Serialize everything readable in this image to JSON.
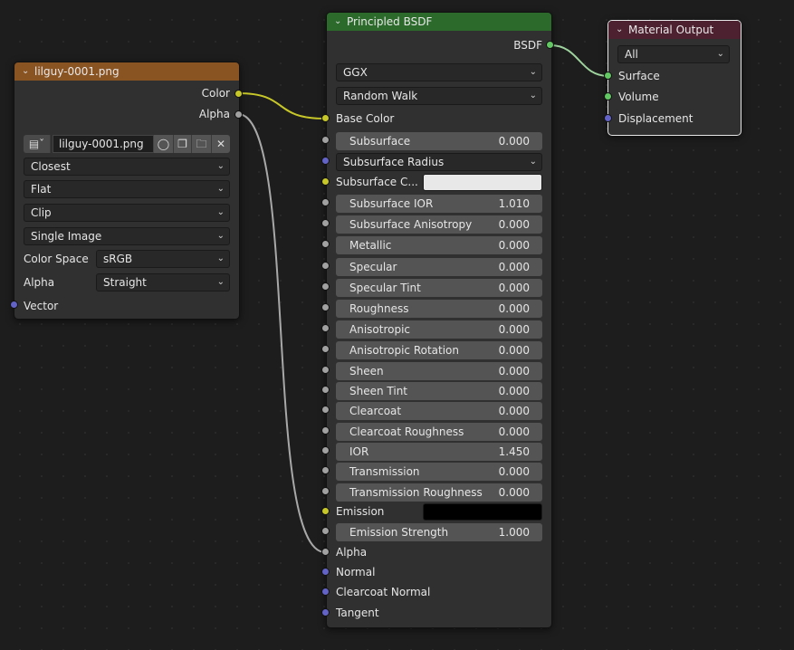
{
  "image_node": {
    "title": "lilguy-0001.png",
    "outputs": {
      "color": "Color",
      "alpha": "Alpha"
    },
    "image_name": "lilguy-0001.png",
    "interpolation": "Closest",
    "projection": "Flat",
    "extension": "Clip",
    "source": "Single Image",
    "color_space_label": "Color Space",
    "color_space": "sRGB",
    "alpha_label": "Alpha",
    "alpha_mode": "Straight",
    "input_vector": "Vector"
  },
  "bsdf_node": {
    "title": "Principled BSDF",
    "output": "BSDF",
    "distribution": "GGX",
    "subsurface_method": "Random Walk",
    "base_color": "Base Color",
    "fields": [
      {
        "label": "Subsurface",
        "value": "0.000"
      },
      {
        "label": "Subsurface Radius",
        "value": ""
      },
      {
        "label": "Subsurface C...",
        "value": ""
      },
      {
        "label": "Subsurface IOR",
        "value": "1.010"
      },
      {
        "label": "Subsurface Anisotropy",
        "value": "0.000"
      },
      {
        "label": "Metallic",
        "value": "0.000"
      },
      {
        "label": "Specular",
        "value": "0.000"
      },
      {
        "label": "Specular Tint",
        "value": "0.000"
      },
      {
        "label": "Roughness",
        "value": "0.000"
      },
      {
        "label": "Anisotropic",
        "value": "0.000"
      },
      {
        "label": "Anisotropic Rotation",
        "value": "0.000"
      },
      {
        "label": "Sheen",
        "value": "0.000"
      },
      {
        "label": "Sheen Tint",
        "value": "0.000"
      },
      {
        "label": "Clearcoat",
        "value": "0.000"
      },
      {
        "label": "Clearcoat Roughness",
        "value": "0.000"
      },
      {
        "label": "IOR",
        "value": "1.450"
      },
      {
        "label": "Transmission",
        "value": "0.000"
      },
      {
        "label": "Transmission Roughness",
        "value": "0.000"
      },
      {
        "label": "Emission",
        "value": ""
      },
      {
        "label": "Emission Strength",
        "value": "1.000"
      }
    ],
    "alpha": "Alpha",
    "normal": "Normal",
    "clearcoat_normal": "Clearcoat Normal",
    "tangent": "Tangent",
    "subsurface_color": "#e8e8e8",
    "emission_color": "#000000"
  },
  "output_node": {
    "title": "Material Output",
    "target": "All",
    "surface": "Surface",
    "volume": "Volume",
    "displacement": "Displacement"
  },
  "colors": {
    "image_header": "#8a5322",
    "bsdf_header": "#2b6a2b",
    "output_header": "#4e2130",
    "socket_color": "#c7c729",
    "socket_float": "#a1a1a1",
    "socket_vector": "#6363c7",
    "socket_shader": "#63c763",
    "link_color": "#c7c729",
    "link_float": "#a1a1a1",
    "link_shader": "#63c763"
  }
}
